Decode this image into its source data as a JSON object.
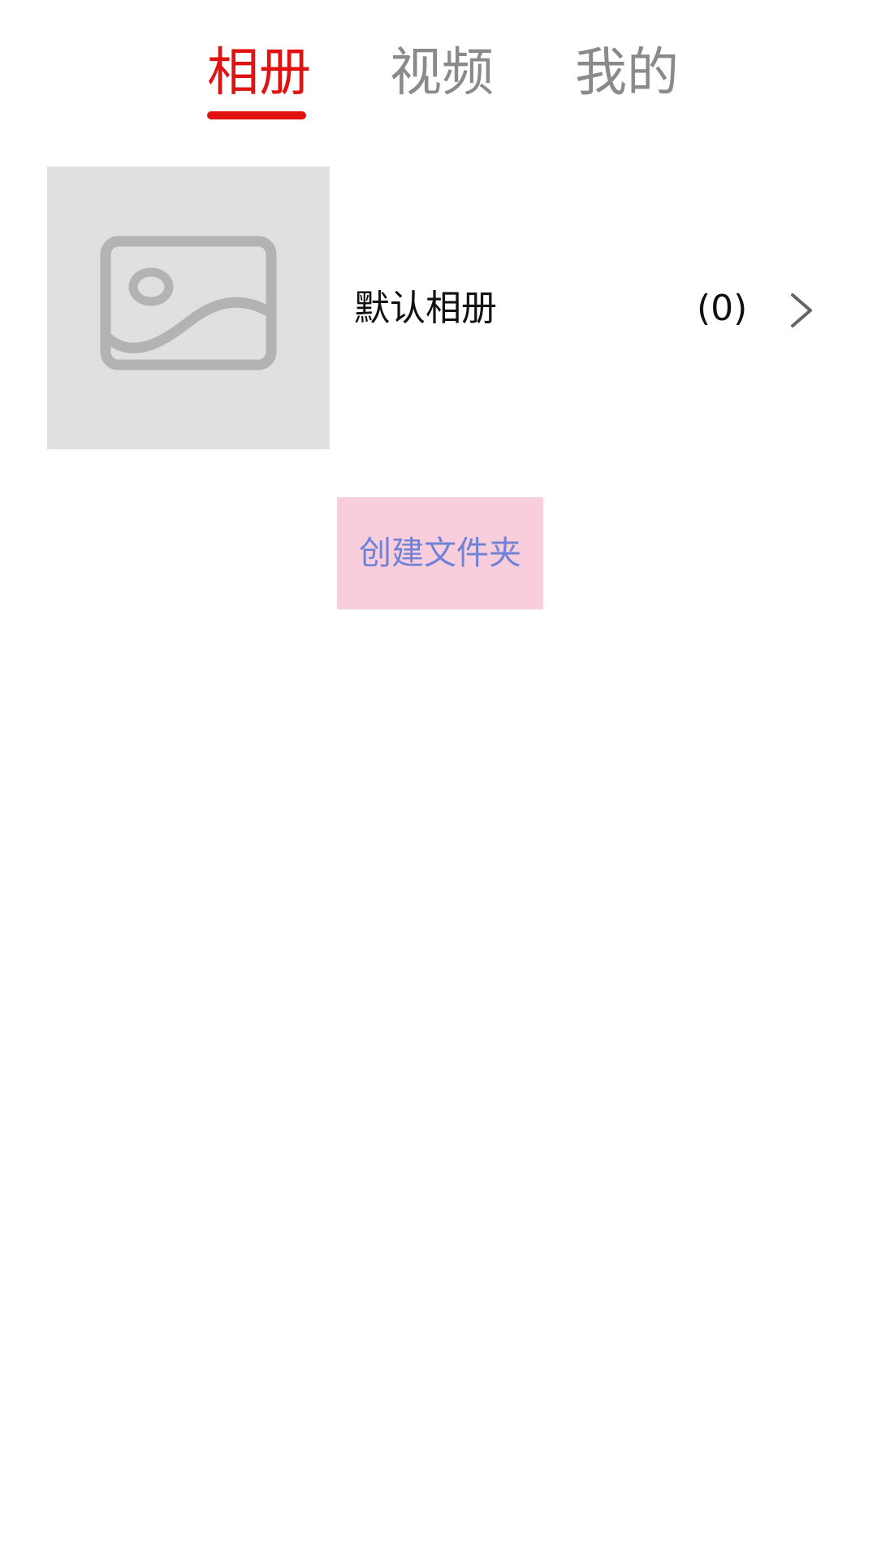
{
  "tabs": {
    "items": [
      {
        "label": "相册",
        "active": true
      },
      {
        "label": "视频",
        "active": false
      },
      {
        "label": "我的",
        "active": false
      }
    ],
    "active_color": "#e11212",
    "inactive_color": "#8a8a8a"
  },
  "albums": [
    {
      "name": "默认相册",
      "count_text": "(0)",
      "thumbnail_icon": "image-placeholder-icon",
      "chevron_icon": "chevron-right-icon"
    }
  ],
  "actions": {
    "create_folder_label": "创建文件夹",
    "create_folder_bg": "#f9cedc",
    "create_folder_text_color": "#6f82d6"
  }
}
